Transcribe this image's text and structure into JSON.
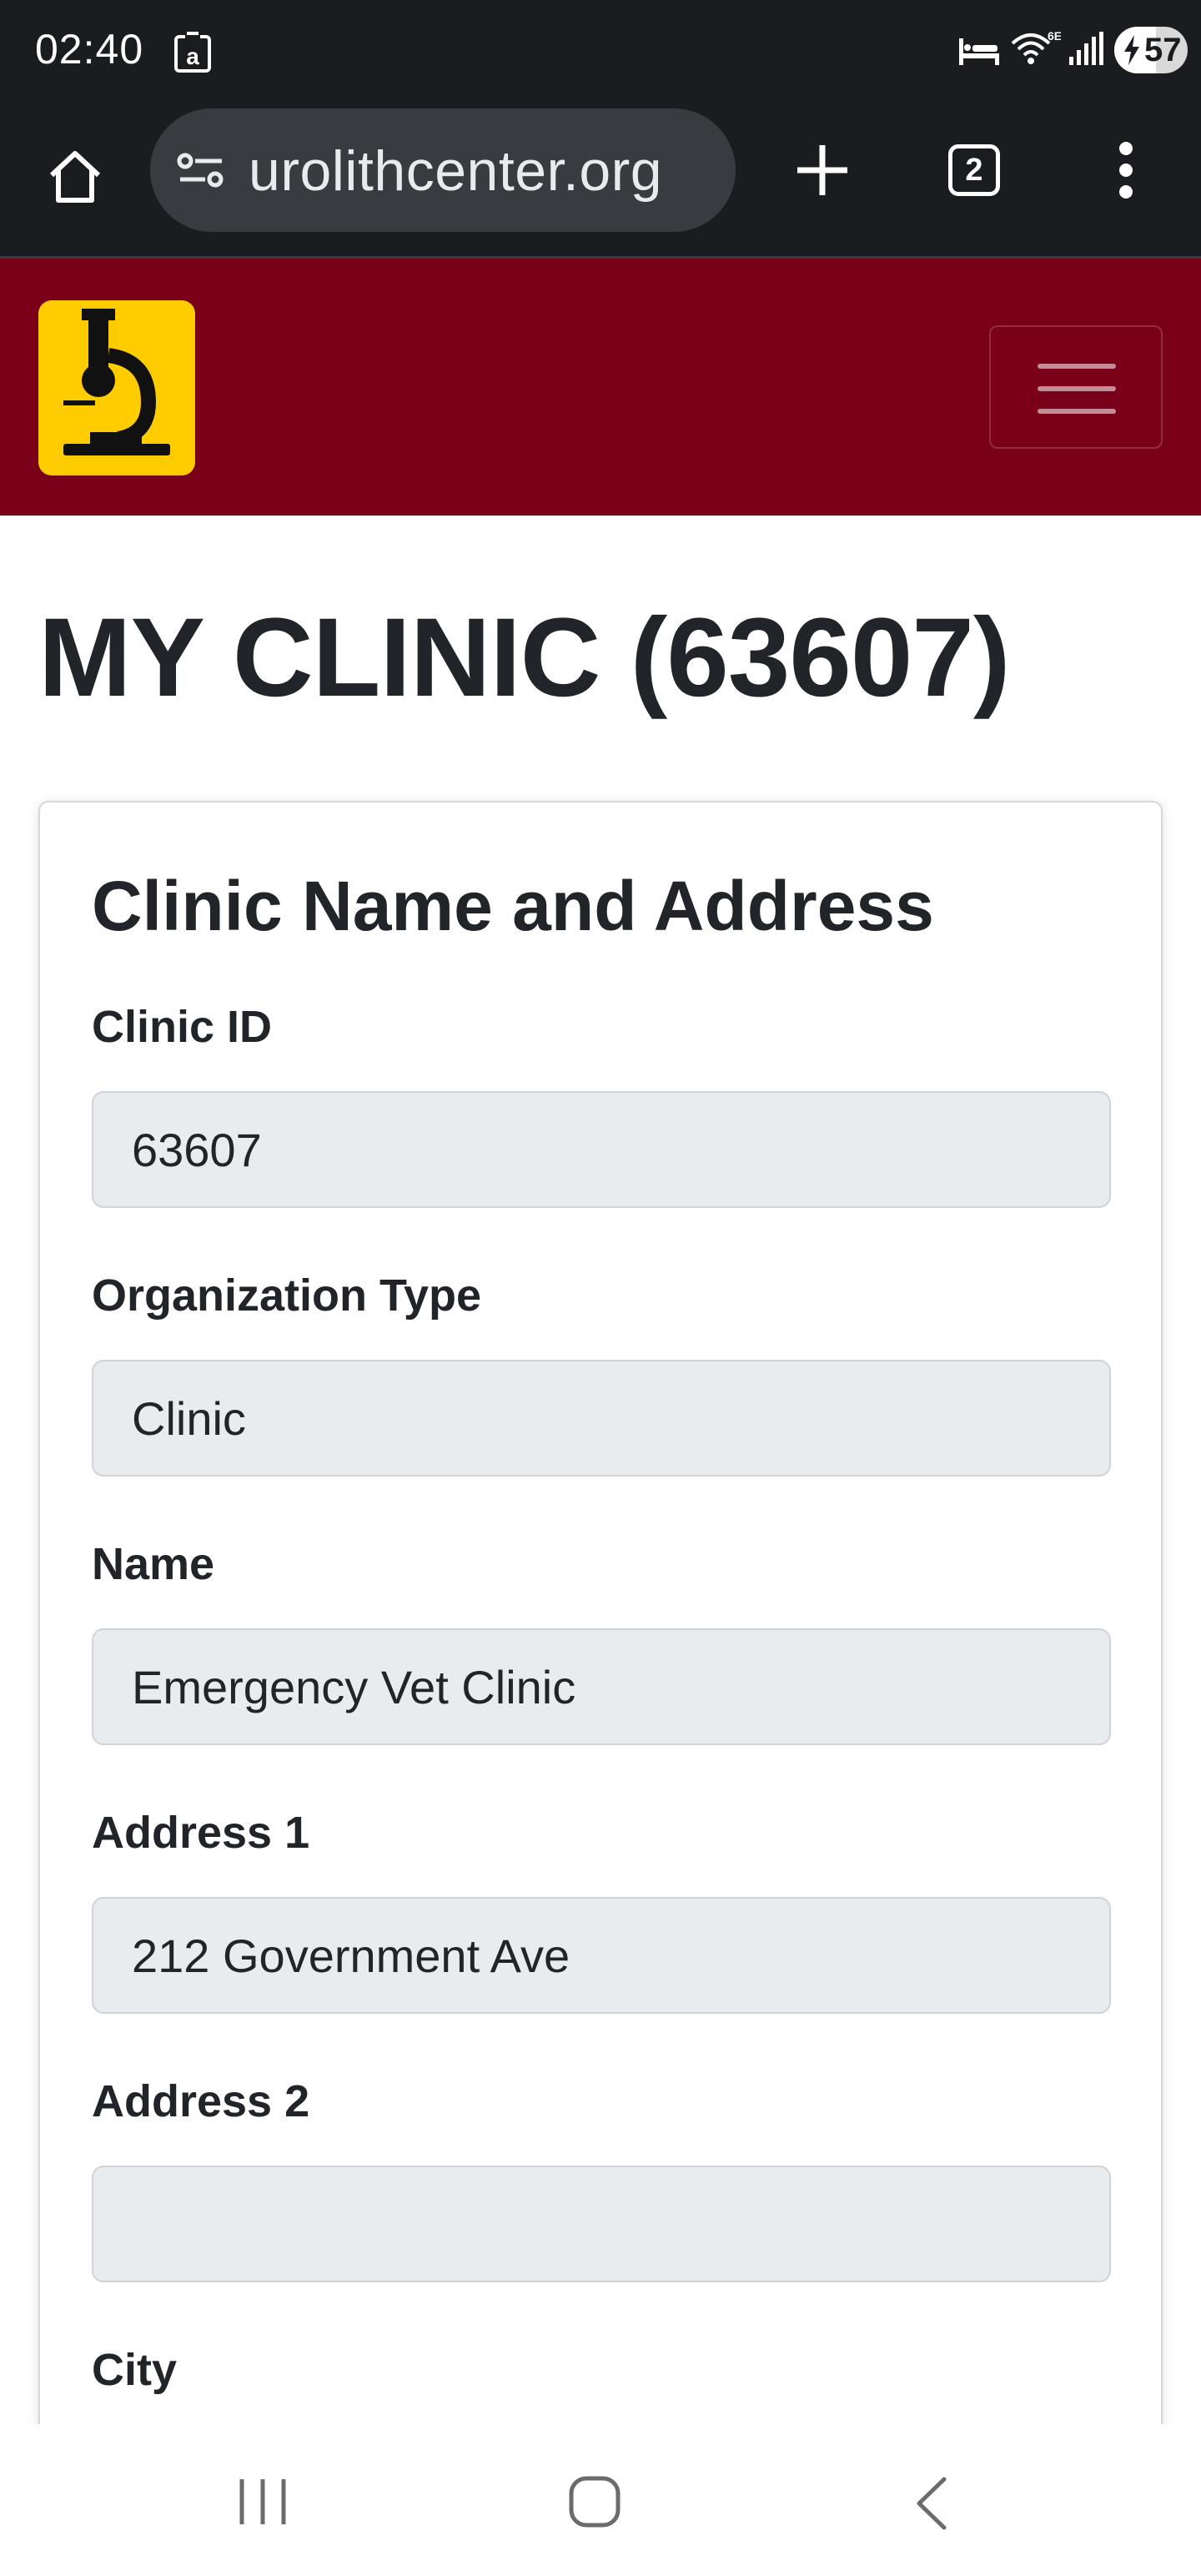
{
  "status_bar": {
    "time": "02:40",
    "battery_level": "57",
    "icons": [
      "a-notification-icon",
      "bed-icon",
      "wifi-6e-icon",
      "signal-icon",
      "battery-charging-icon"
    ]
  },
  "browser": {
    "url": "urolithcenter.org",
    "tab_count": "2",
    "icons": [
      "home-icon",
      "site-settings-icon",
      "plus-icon",
      "tabs-icon",
      "more-vert-icon"
    ]
  },
  "navbar": {
    "brand_color": "#7a0019",
    "logo_color": "#ffcc00",
    "logo_icon": "microscope-icon",
    "toggler_icon": "hamburger-icon"
  },
  "page": {
    "title": "MY CLINIC (63607)"
  },
  "card": {
    "title": "Clinic Name and Address",
    "fields": [
      {
        "label": "Clinic ID",
        "value": "63607"
      },
      {
        "label": "Organization Type",
        "value": "Clinic"
      },
      {
        "label": "Name",
        "value": "Emergency Vet Clinic"
      },
      {
        "label": "Address 1",
        "value": "212 Government Ave"
      },
      {
        "label": "Address 2",
        "value": ""
      },
      {
        "label": "City",
        "value": ""
      }
    ]
  },
  "android_nav": {
    "icons": [
      "recents-icon",
      "home-icon",
      "back-icon"
    ]
  }
}
